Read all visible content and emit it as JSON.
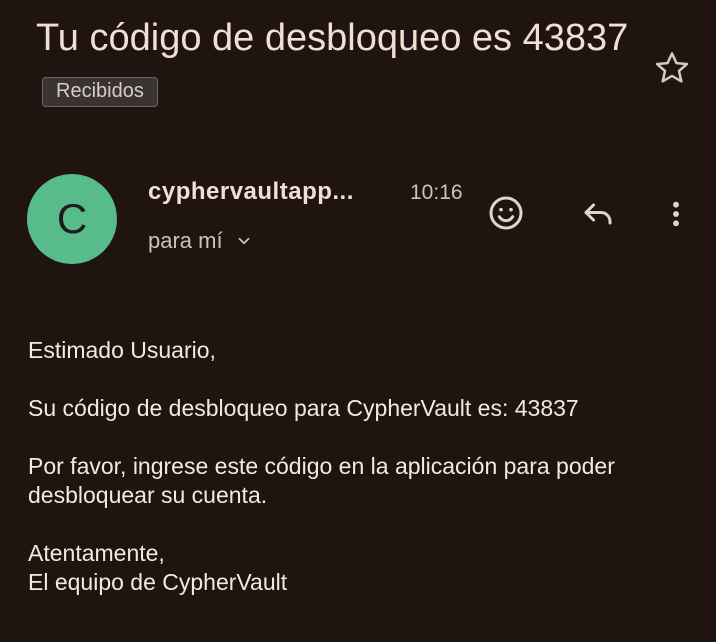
{
  "email": {
    "subject": "Tu código de desbloqueo es 43837",
    "label": "Recibidos",
    "sender_initial": "C",
    "sender_name": "cyphervaultapp...",
    "time": "10:16",
    "recipient_text": "para mí",
    "body": {
      "greeting": "Estimado Usuario,",
      "line1": "Su código de desbloqueo para CypherVault es: 43837",
      "line2a": "Por favor, ingrese este código en la aplicación para poder",
      "line2b": "desbloquear su cuenta.",
      "closing": "Atentamente,",
      "signature": "El equipo de CypherVault"
    }
  },
  "icons": {
    "star": "star-outline-icon",
    "emoji": "add-reaction-icon",
    "reply": "reply-icon",
    "more": "more-vert-icon",
    "expand": "chevron-down-icon"
  },
  "colors": {
    "background": "#1f1410",
    "avatar": "#57bb8a",
    "text": "#f1dfd3"
  }
}
